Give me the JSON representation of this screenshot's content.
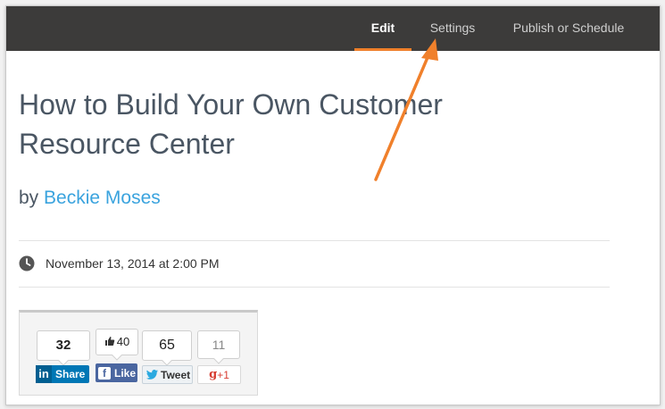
{
  "topbar": {
    "tabs": [
      {
        "label": "Edit",
        "active": true
      },
      {
        "label": "Settings",
        "active": false
      },
      {
        "label": "Publish or Schedule",
        "active": false
      }
    ],
    "accent_color": "#f0802b"
  },
  "post": {
    "title": "How to Build Your Own Customer Resource Center",
    "by_prefix": "by",
    "author": "Beckie Moses",
    "date": "November 13, 2014 at 2:00 PM"
  },
  "share": {
    "linkedin": {
      "count": "32",
      "icon_text": "in",
      "label": "Share"
    },
    "facebook": {
      "count": "40",
      "icon_text": "f",
      "label": "Like"
    },
    "twitter": {
      "count": "65",
      "label": "Tweet"
    },
    "googleplus": {
      "count": "11",
      "icon_text": "g",
      "label": "+1"
    }
  },
  "icons": {
    "clock": "clock-icon",
    "annotation": "orange-arrow-icon"
  }
}
